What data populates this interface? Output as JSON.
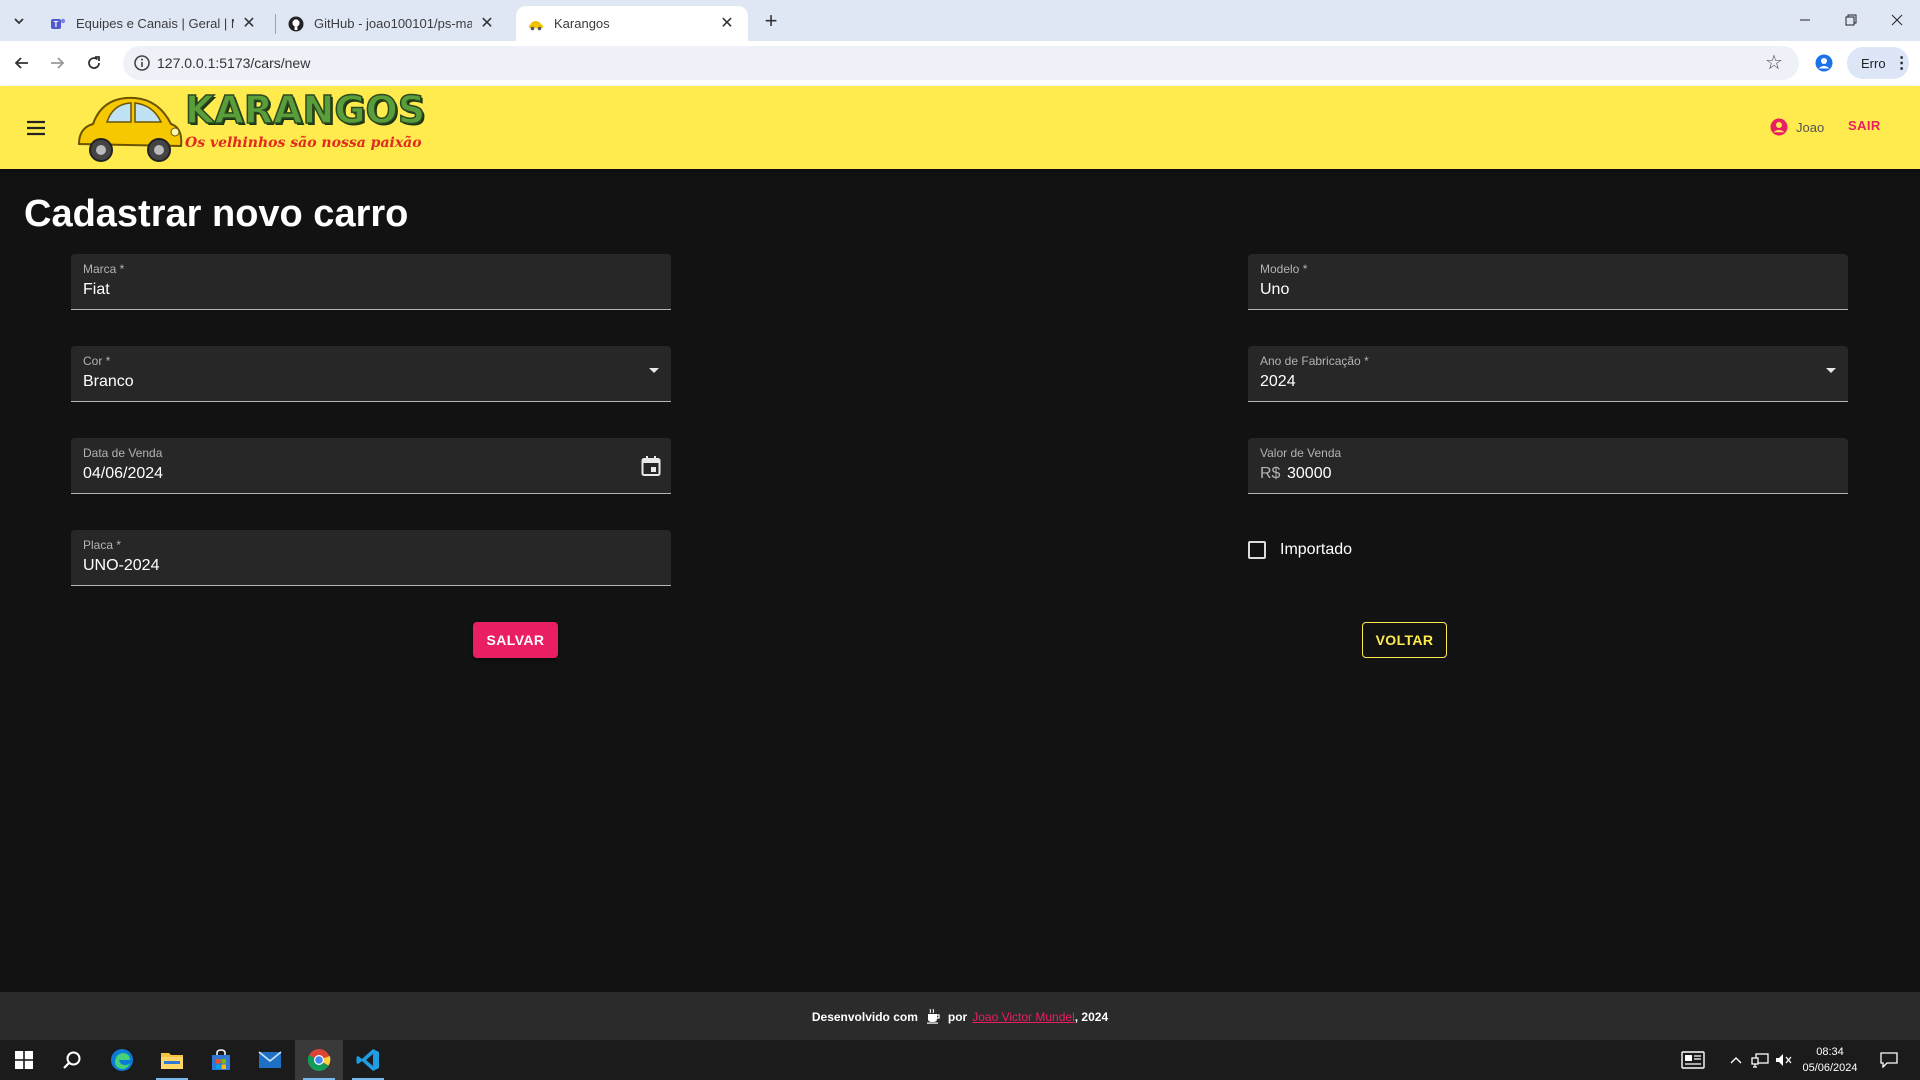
{
  "browser": {
    "tabs": [
      {
        "title": "Equipes e Canais | Geral | Micro",
        "icon": "teams-icon"
      },
      {
        "title": "GitHub - joao100101/ps-mat-2",
        "icon": "github-icon"
      },
      {
        "title": "Karangos",
        "icon": "car-icon"
      }
    ],
    "url": "127.0.0.1:5173/cars/new",
    "profile_status": "Erro"
  },
  "app": {
    "logo": {
      "title": "KARANGOS",
      "subtitle": "Os velhinhos são nossa paixão"
    },
    "user": {
      "name": "Joao",
      "logout_label": "SAIR"
    },
    "page_title": "Cadastrar novo carro",
    "form": {
      "brand": {
        "label": "Marca *",
        "value": "Fiat"
      },
      "model": {
        "label": "Modelo *",
        "value": "Uno"
      },
      "color": {
        "label": "Cor *",
        "value": "Branco"
      },
      "year": {
        "label": "Ano de Fabricação *",
        "value": "2024"
      },
      "sale_date": {
        "label": "Data de Venda",
        "value": "04/06/2024"
      },
      "sale_price": {
        "label": "Valor de Venda",
        "prefix": "R$",
        "value": "30000"
      },
      "plate": {
        "label": "Placa *",
        "value": "UNO-2024"
      },
      "imported": {
        "label": "Importado",
        "checked": false
      },
      "save_label": "SALVAR",
      "back_label": "VOLTAR"
    },
    "footer": {
      "prefix": "Desenvolvido com",
      "by": "por",
      "author": "Joao Victor Mundel",
      "year_suffix": ", 2024"
    }
  },
  "taskbar": {
    "time": "08:34",
    "date": "05/06/2024"
  },
  "colors": {
    "appbar": "#ffeb4d",
    "primary": "#e91e63",
    "background": "#121212",
    "field": "#272727"
  }
}
